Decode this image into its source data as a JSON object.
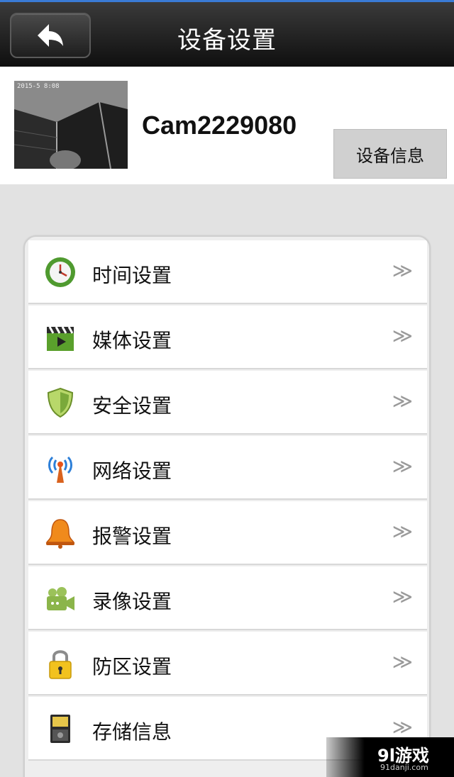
{
  "header": {
    "title": "设备设置",
    "back_icon": "back-arrow-icon"
  },
  "device": {
    "thumbnail_timestamp": "2015-5 8:08",
    "name": "Cam2229080",
    "info_button": "设备信息"
  },
  "menu": [
    {
      "label": "时间设置",
      "icon": "clock-icon",
      "arrow": "≫"
    },
    {
      "label": "媒体设置",
      "icon": "clapperboard-icon",
      "arrow": "≫"
    },
    {
      "label": "安全设置",
      "icon": "shield-icon",
      "arrow": "≫"
    },
    {
      "label": "网络设置",
      "icon": "wireless-antenna-icon",
      "arrow": "≫"
    },
    {
      "label": "报警设置",
      "icon": "bell-icon",
      "arrow": "≫"
    },
    {
      "label": "录像设置",
      "icon": "video-camera-icon",
      "arrow": "≫"
    },
    {
      "label": "防区设置",
      "icon": "padlock-icon",
      "arrow": "≫"
    },
    {
      "label": "存储信息",
      "icon": "storage-card-icon",
      "arrow": "≫"
    }
  ],
  "watermark": {
    "logo": "9l游戏",
    "site": "91danji.com"
  }
}
